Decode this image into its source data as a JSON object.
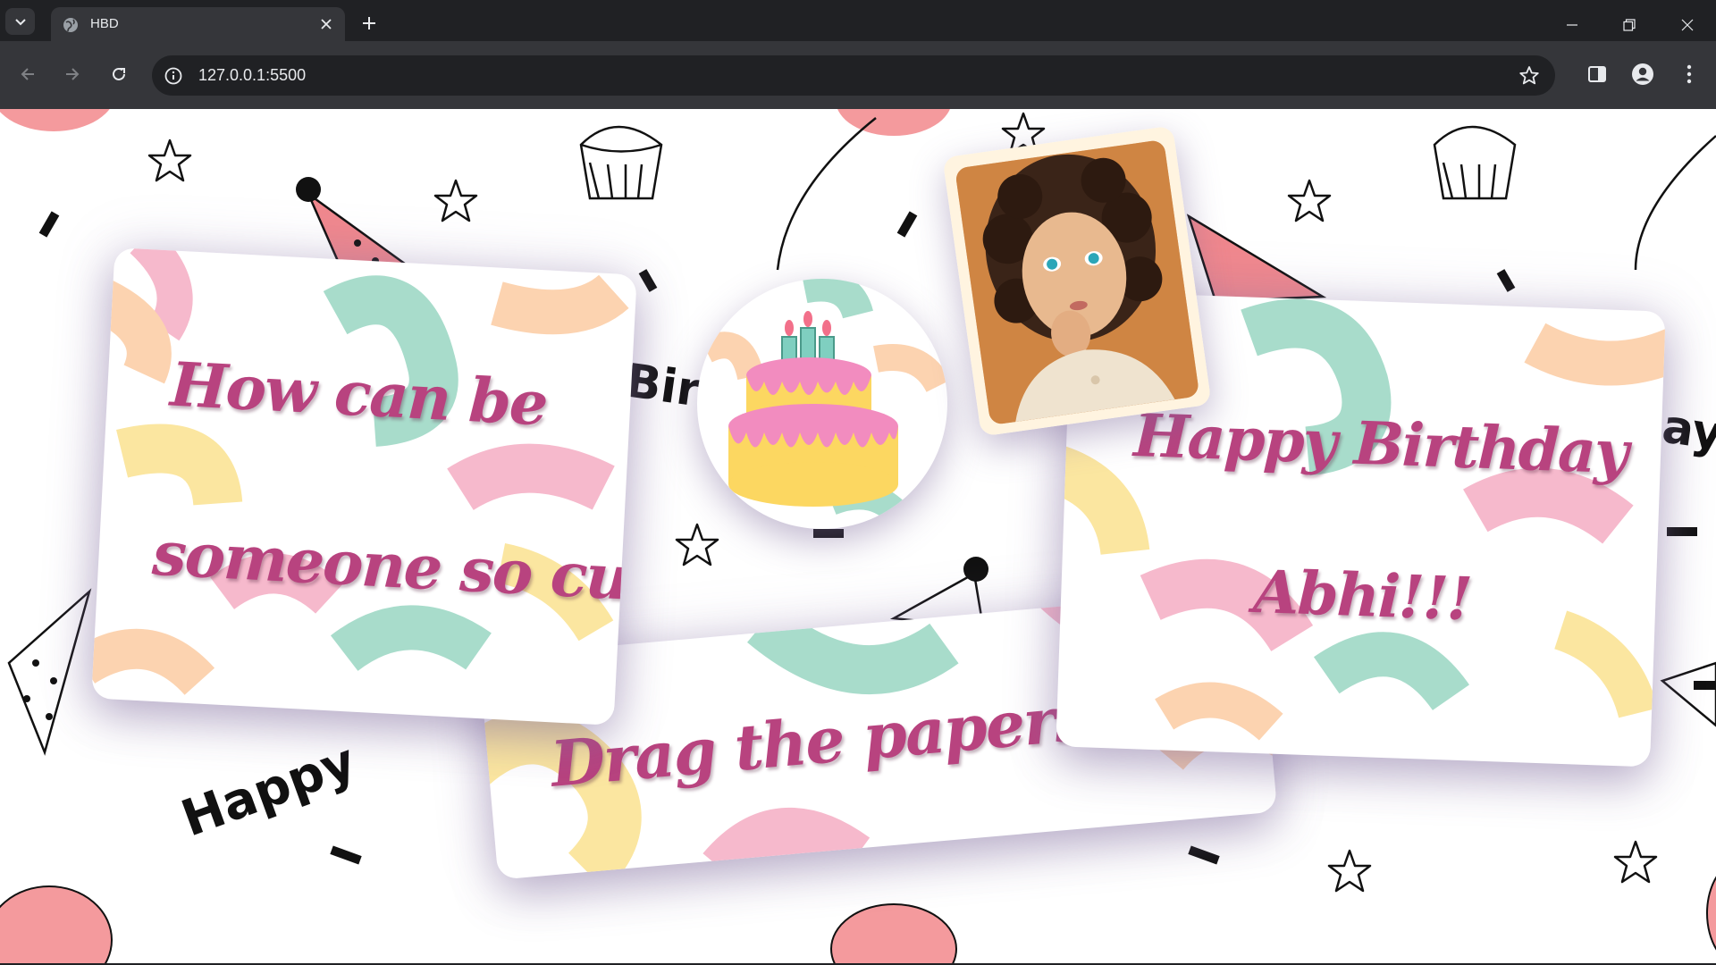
{
  "browser": {
    "tab_title": "HBD",
    "url": "127.0.0.1:5500"
  },
  "background": {
    "word_happy": "Happy",
    "word_birthday_partial": "Bir",
    "word_day_partial": "ay"
  },
  "papers": {
    "left": {
      "line1": "How can be",
      "line2": "someone so cute"
    },
    "right": {
      "line1": "Happy Birthday",
      "line2": "Abhi!!!"
    },
    "bottom": {
      "text": "Drag the papers to move!"
    }
  },
  "icons": {
    "tab_search": "chevron-down-icon",
    "favicon": "globe-icon",
    "close": "close-icon",
    "new_tab": "plus-icon",
    "back": "back-arrow-icon",
    "forward": "forward-arrow-icon",
    "reload": "reload-icon",
    "site_info": "info-icon",
    "bookmark": "star-icon",
    "side_panel": "side-panel-icon",
    "profile": "profile-icon",
    "menu": "kebab-menu-icon"
  },
  "colors": {
    "accent_text": "#b8437f",
    "mint": "#a8dccb",
    "pink": "#f6b9cc",
    "peach": "#fcd3b0",
    "yellow": "#fbe6a0"
  }
}
